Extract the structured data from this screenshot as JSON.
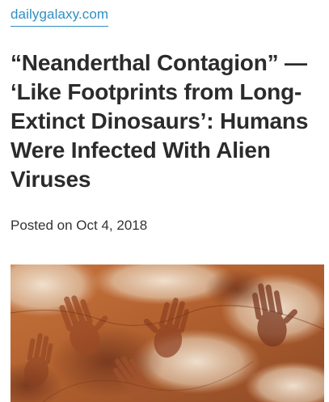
{
  "site": {
    "name": "dailygalaxy.com",
    "link_color": "#2f8fc4"
  },
  "article": {
    "title": "“Neanderthal Contagion” — ‘Like Footprints from Long-Extinct Dinosaurs’: Humans Were Infected With Alien Viruses",
    "posted_prefix": "Posted on",
    "posted_date": "Oct 4, 2018",
    "hero_image": {
      "subject": "cave-wall-hand-stencils",
      "dominant_colors": [
        "#b86a38",
        "#e9d6c2",
        "#7a3b22"
      ]
    }
  }
}
